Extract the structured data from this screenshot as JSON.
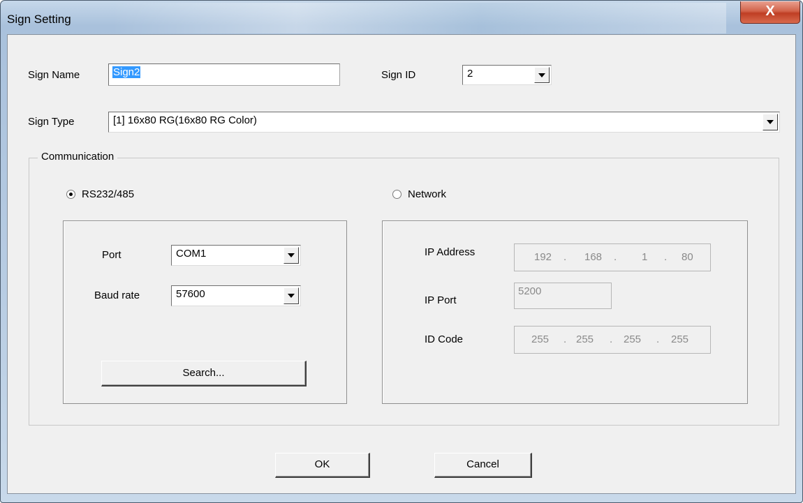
{
  "window": {
    "title": "Sign Setting",
    "close_symbol": "X"
  },
  "form": {
    "sign_name_label": "Sign Name",
    "sign_name_value": "Sign2",
    "sign_id_label": "Sign ID",
    "sign_id_value": "2",
    "sign_type_label": "Sign Type",
    "sign_type_value": "[1] 16x80 RG(16x80 RG Color)"
  },
  "communication": {
    "group_label": "Communication",
    "rs232_label": "RS232/485",
    "rs232_selected": true,
    "network_label": "Network",
    "network_selected": false,
    "port_label": "Port",
    "port_value": "COM1",
    "baud_label": "Baud rate",
    "baud_value": "57600",
    "search_label": "Search...",
    "ip_address_label": "IP Address",
    "ip_address": [
      "192",
      "168",
      "1",
      "80"
    ],
    "ip_port_label": "IP Port",
    "ip_port_value": "5200",
    "id_code_label": "ID Code",
    "id_code": [
      "255",
      "255",
      "255",
      "255"
    ]
  },
  "buttons": {
    "ok": "OK",
    "cancel": "Cancel"
  }
}
